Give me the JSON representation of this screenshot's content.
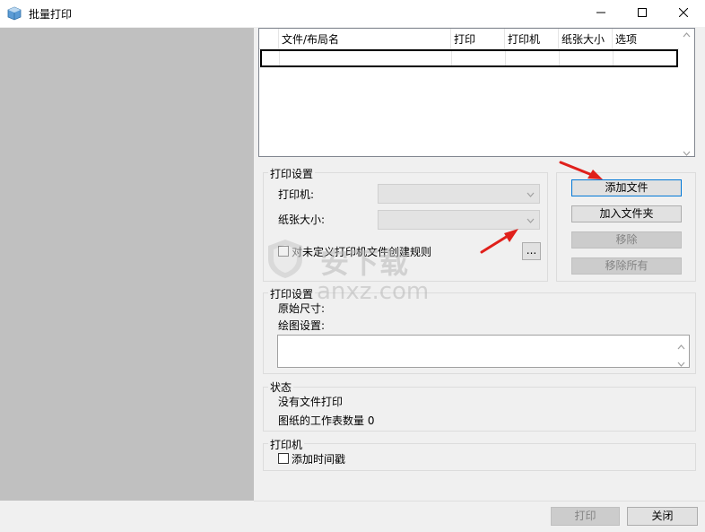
{
  "window": {
    "title": "批量打印",
    "minimize_glyph": "─",
    "maximize_glyph": "☐",
    "close_glyph": "✕"
  },
  "file_list": {
    "columns": [
      "文件/布局名",
      "打印",
      "打印机",
      "纸张大小",
      "选项"
    ],
    "rows": []
  },
  "print_settings": {
    "group_label": "打印设置",
    "printer_label": "打印机:",
    "printer_value": "",
    "paper_size_label": "纸张大小:",
    "paper_size_value": "",
    "undefined_printer_rule_label": "对未定义打印机文件创建规则",
    "undefined_printer_rule_checked": false,
    "browse_label": "..."
  },
  "file_buttons": {
    "add_file": "添加文件",
    "add_folder": "加入文件夹",
    "remove": "移除",
    "remove_all": "移除所有"
  },
  "plot_settings": {
    "group_label": "打印设置",
    "original_size_label": "原始尺寸:",
    "drawing_settings_label": "绘图设置:",
    "drawing_settings_value": ""
  },
  "status": {
    "group_label": "状态",
    "message": "没有文件打印",
    "sheet_count_label": "图纸的工作表数量 0"
  },
  "printer": {
    "group_label": "打印机",
    "add_timestamp_label": "添加时间戳",
    "add_timestamp_checked": false
  },
  "footer": {
    "print_label": "打印",
    "close_label": "关闭"
  },
  "watermark": {
    "text": "安下载",
    "domain": "anxz.com"
  },
  "colors": {
    "annotation_arrow": "#e0201b",
    "accent": "#0078d7"
  }
}
